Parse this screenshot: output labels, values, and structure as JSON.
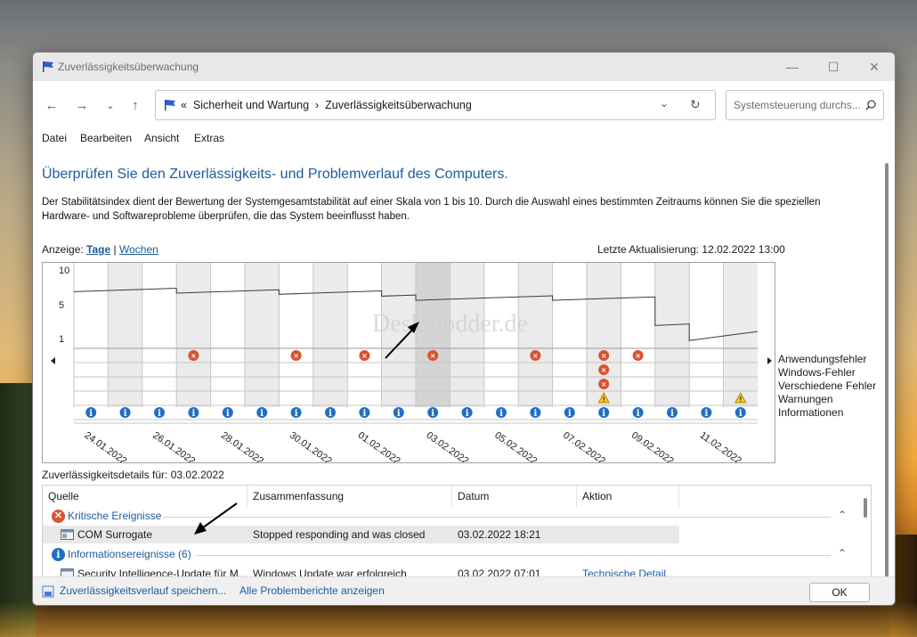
{
  "window": {
    "title": "Zuverlässigkeitsüberwachung",
    "minimize": "—",
    "maximize": "☐",
    "close": "✕"
  },
  "nav": {
    "back": "←",
    "forward": "→",
    "recent": "⌄",
    "up": "↑"
  },
  "address": {
    "prefix": "«",
    "crumb1": "Sicherheit und Wartung",
    "sep": "›",
    "crumb2": "Zuverlässigkeitsüberwachung",
    "refresh": "↻",
    "dropdown": "⌄"
  },
  "search": {
    "placeholder": "Systemsteuerung durchs...",
    "icon": "search-icon"
  },
  "menu": [
    "Datei",
    "Bearbeiten",
    "Ansicht",
    "Extras"
  ],
  "heading": "Überprüfen Sie den Zuverlässigkeits- und Problemverlauf des Computers.",
  "description": "Der Stabilitätsindex dient der Bewertung der Systemgesamtstabilität auf einer Skala von 1 bis 10. Durch die Auswahl eines bestimmten Zeitraums können Sie die speziellen Hardware- und Softwareprobleme überprüfen, die das System beeinflusst haben.",
  "view": {
    "label": "Anzeige:",
    "days": "Tage",
    "sep": "|",
    "weeks": "Wochen"
  },
  "last_update": "Letzte Aktualisierung: 12.02.2022 13:00",
  "watermark": "Deskmodder.de",
  "chart_data": {
    "type": "line",
    "y_ticks": [
      "10",
      "5",
      "1"
    ],
    "ylim": [
      1,
      10
    ],
    "x_labels": [
      "24.01.2022",
      "26.01.2022",
      "28.01.2022",
      "30.01.2022",
      "01.02.2022",
      "03.02.2022",
      "05.02.2022",
      "07.02.2022",
      "09.02.2022",
      "11.02.2022"
    ],
    "columns": 20,
    "selected_column": 10,
    "stability_index": [
      [
        0,
        8.3
      ],
      [
        1,
        8.45
      ],
      [
        2,
        8.6
      ],
      [
        3,
        8.75
      ],
      [
        3,
        8.1
      ],
      [
        4,
        8.25
      ],
      [
        5,
        8.4
      ],
      [
        6,
        8.55
      ],
      [
        6,
        7.95
      ],
      [
        7,
        8.1
      ],
      [
        8,
        8.25
      ],
      [
        9,
        8.4
      ],
      [
        9,
        7.7
      ],
      [
        10,
        7.85
      ],
      [
        10,
        7.15
      ],
      [
        11,
        7.3
      ],
      [
        12,
        7.45
      ],
      [
        13,
        7.6
      ],
      [
        14,
        7.75
      ],
      [
        14,
        7.15
      ],
      [
        15,
        7.3
      ],
      [
        16,
        7.45
      ],
      [
        17,
        7.6
      ],
      [
        17,
        3.8
      ],
      [
        18,
        4.0
      ],
      [
        18,
        1.8
      ],
      [
        19,
        2.4
      ],
      [
        20,
        3.0
      ]
    ],
    "rows": [
      "Anwendungsfehler",
      "Windows-Fehler",
      "Verschiedene Fehler",
      "Warnungen",
      "Informationen"
    ],
    "events": {
      "Anwendungsfehler": [
        3,
        6,
        8,
        10,
        13,
        15,
        16
      ],
      "Windows-Fehler": [
        15
      ],
      "Verschiedene Fehler": [
        15
      ],
      "Warnungen": [
        15,
        19
      ],
      "Informationen": [
        0,
        1,
        2,
        3,
        4,
        5,
        6,
        7,
        8,
        9,
        10,
        11,
        12,
        13,
        14,
        15,
        16,
        17,
        18,
        19
      ]
    }
  },
  "details": {
    "label": "Zuverlässigkeitsdetails für: 03.02.2022",
    "columns": [
      "Quelle",
      "Zusammenfassung",
      "Datum",
      "Aktion"
    ],
    "group_critical": "Kritische Ereignisse",
    "row1": {
      "source": "COM Surrogate",
      "summary": "Stopped responding and was closed",
      "date": "03.02.2022 18:21",
      "action": ""
    },
    "group_info": "Informationsereignisse (6)",
    "row2": {
      "source": "Security Intelligence-Update für M...",
      "summary": "Windows Update war erfolgreich",
      "date": "03.02.2022 07:01",
      "action": "Technische Detail..."
    }
  },
  "footer": {
    "save_link": "Zuverlässigkeitsverlauf speichern...",
    "reports_link": "Alle Problemberichte anzeigen",
    "ok": "OK"
  }
}
